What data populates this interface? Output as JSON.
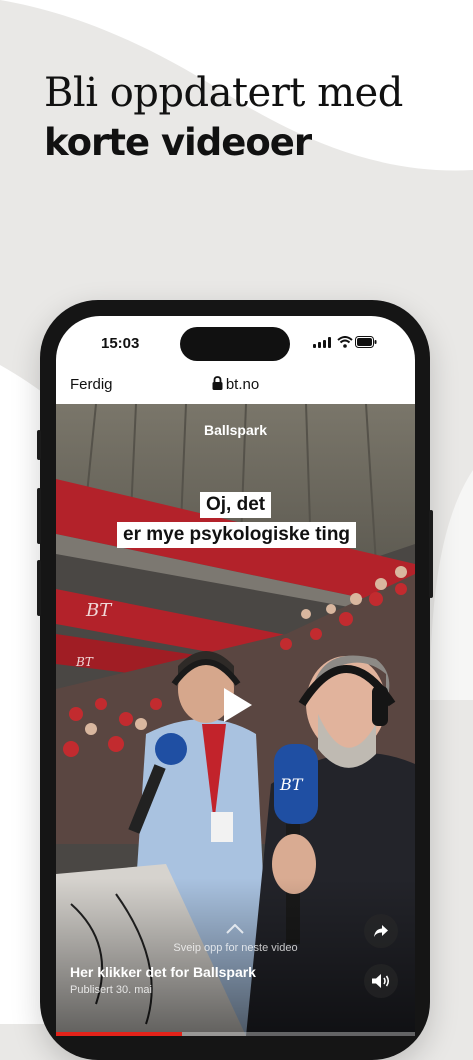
{
  "headline": {
    "line1": "Bli oppdatert med",
    "line2": "korte videoer"
  },
  "status_bar": {
    "time": "15:03",
    "icons": [
      "signal-icon",
      "wifi-icon",
      "battery-icon"
    ]
  },
  "browser": {
    "done_label": "Ferdig",
    "url": "bt.no",
    "lock_icon": "lock-icon"
  },
  "video": {
    "category": "Ballspark",
    "caption_lines": [
      "Oj, det",
      "er mye psykologiske ting"
    ],
    "swipe_hint": "Sveip opp for neste video",
    "title": "Her klikker det for Ballspark",
    "published": "Publisert 30. mai",
    "progress": 0.35,
    "share_icon": "share-icon",
    "sound_icon": "speaker-icon",
    "play_icon": "play-icon",
    "mic_logo": "BT"
  },
  "colors": {
    "accent": "#e2231a",
    "background": "#e9e8e6"
  }
}
